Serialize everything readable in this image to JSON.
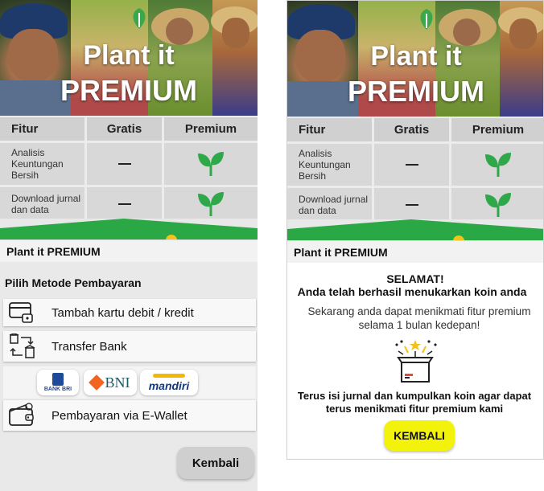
{
  "hero": {
    "line1": "Plant it",
    "line2": "PREMIUM"
  },
  "table": {
    "headers": [
      "Fitur",
      "Gratis",
      "Premium"
    ],
    "rows": [
      {
        "feature": "Analisis Keuntungan Bersih",
        "free": "—"
      },
      {
        "feature": "Download jurnal dan data",
        "free": "—"
      }
    ]
  },
  "left": {
    "sheet_title": "Plant it PREMIUM",
    "methods_title": "Pilih Metode Pembayaran",
    "methods": {
      "card": "Tambah kartu debit / kredit",
      "transfer": "Transfer Bank",
      "ewallet": "Pembayaran via E-Wallet"
    },
    "banks": {
      "bri_label": "BANK BRI",
      "bni_label": "BNI",
      "mandiri_label": "mandiri"
    },
    "back_label": "Kembali"
  },
  "right": {
    "sheet_title": "Plant it PREMIUM",
    "congrats": "SELAMAT!",
    "success": "Anda telah berhasil menukarkan koin anda",
    "enjoy": "Sekarang anda dapat menikmati fitur premium selama 1 bulan kedepan!",
    "keep": "Terus isi jurnal dan kumpulkan koin agar dapat terus menikmati fitur premium kami",
    "back_label": "KEMBALI"
  },
  "colors": {
    "green": "#2aa845",
    "yellow_button": "#f2f20a",
    "coin": "#f3c21b"
  },
  "icons": [
    "sprout-icon",
    "credit-card-icon",
    "bank-transfer-icon",
    "wallet-icon",
    "gift-box-icon",
    "app-logo-icon",
    "coin-icon"
  ]
}
